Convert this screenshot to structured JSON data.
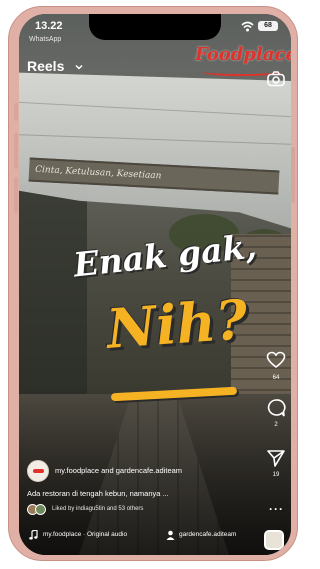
{
  "status_bar": {
    "time": "13.22",
    "back_app": "WhatsApp",
    "battery": "68"
  },
  "header": {
    "title": "Reels",
    "brand_logo_text": "Foodplace!"
  },
  "video": {
    "sign_text": "Cinta, Ketulusan, Kesetiaan",
    "headline_line1": "Enak gak,",
    "headline_line2": "Nih?"
  },
  "actions": {
    "likes_count": "64",
    "comments_count": "2",
    "shares_count": "19"
  },
  "post": {
    "author": "my.foodplace and gardencafe.aditeam",
    "caption": "Ada restoran di tengah kebun, namanya ...",
    "liked_by": "Liked by indiagu5tin and 53 others",
    "audio": "my.foodplace · Original audio",
    "tagged": "gardencafe.aditeam"
  },
  "colors": {
    "device_frame": "#e0b0a6",
    "accent_yellow": "#f5b324",
    "brand_red": "#e0322b"
  },
  "icons": [
    "wifi-icon",
    "chevron-down-icon",
    "camera-icon",
    "heart-icon",
    "comment-icon",
    "share-icon",
    "more-icon",
    "music-icon",
    "person-icon"
  ]
}
